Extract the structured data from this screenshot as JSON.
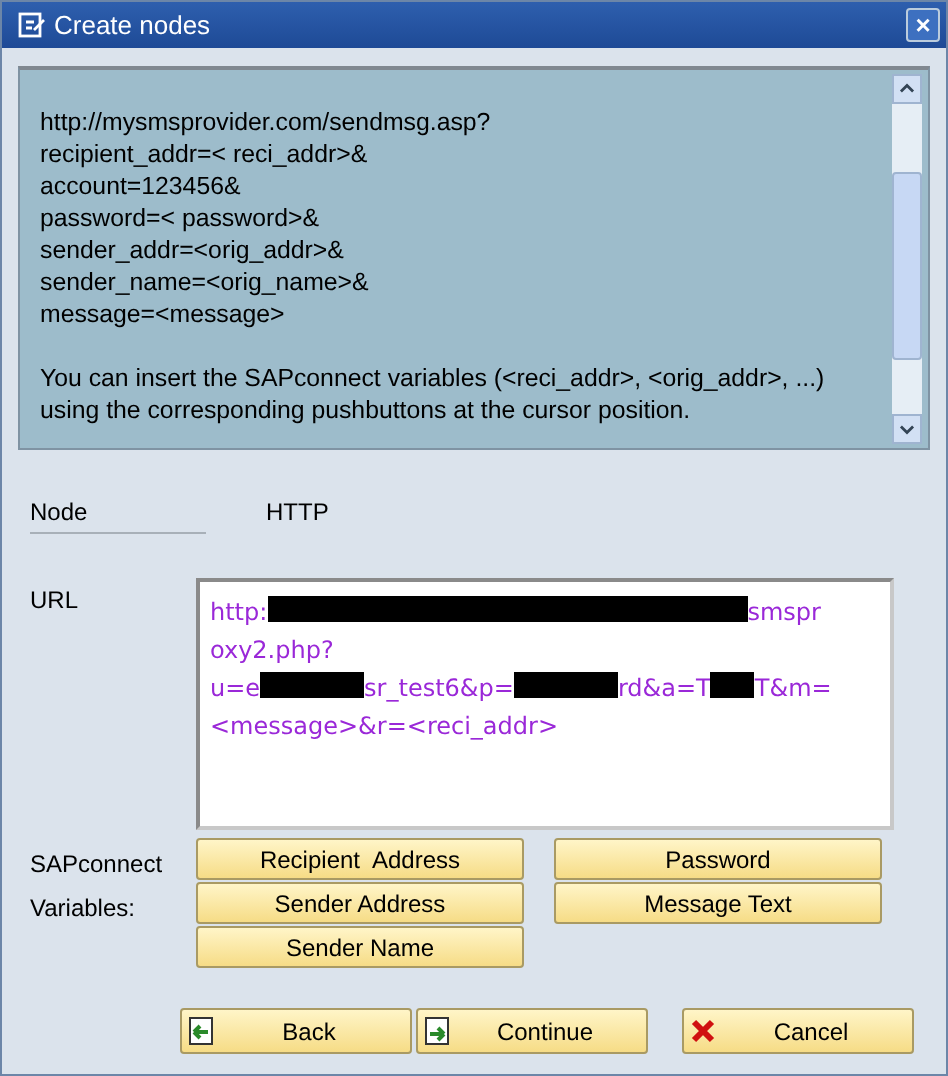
{
  "window": {
    "title": "Create nodes",
    "close": "×"
  },
  "info": {
    "lines": [
      "http://mysmsprovider.com/sendmsg.asp?",
      "recipient_addr=< reci_addr>&",
      "account=123456&",
      "password=< password>&",
      "sender_addr=<orig_addr>&",
      "sender_name=<orig_name>&",
      "message=<message>"
    ],
    "note": "You can insert the SAPconnect variables (<reci_addr>, <orig_addr>, ...) using the corresponding pushbuttons at the cursor position."
  },
  "node": {
    "label": "Node",
    "value": "HTTP"
  },
  "url": {
    "label": "URL",
    "lines": [
      [
        {
          "kind": "text",
          "text": "http:"
        },
        {
          "kind": "longbar"
        },
        {
          "kind": "text",
          "text": "smspr"
        }
      ],
      [
        {
          "kind": "text",
          "text": "oxy2.php?"
        }
      ],
      [
        {
          "kind": "text",
          "text": "u=e"
        },
        {
          "kind": "midbar"
        },
        {
          "kind": "text",
          "text": "sr_test6&p="
        },
        {
          "kind": "midbar"
        },
        {
          "kind": "text",
          "text": "rd&a=T"
        },
        {
          "kind": "shortbar"
        },
        {
          "kind": "text",
          "text": "T&m="
        }
      ],
      [
        {
          "kind": "text",
          "text": "<message>&r=<reci_addr>"
        }
      ]
    ]
  },
  "variables": {
    "label_lines": [
      "SAPconnect",
      "Variables:"
    ],
    "buttons": [
      "Recipient  Address",
      "Password",
      "Sender Address",
      "Message Text",
      "Sender Name"
    ]
  },
  "actions": [
    {
      "kind": "back",
      "label": "Back"
    },
    {
      "kind": "continue",
      "label": "Continue"
    },
    {
      "kind": "cancel",
      "label": "Cancel"
    }
  ]
}
